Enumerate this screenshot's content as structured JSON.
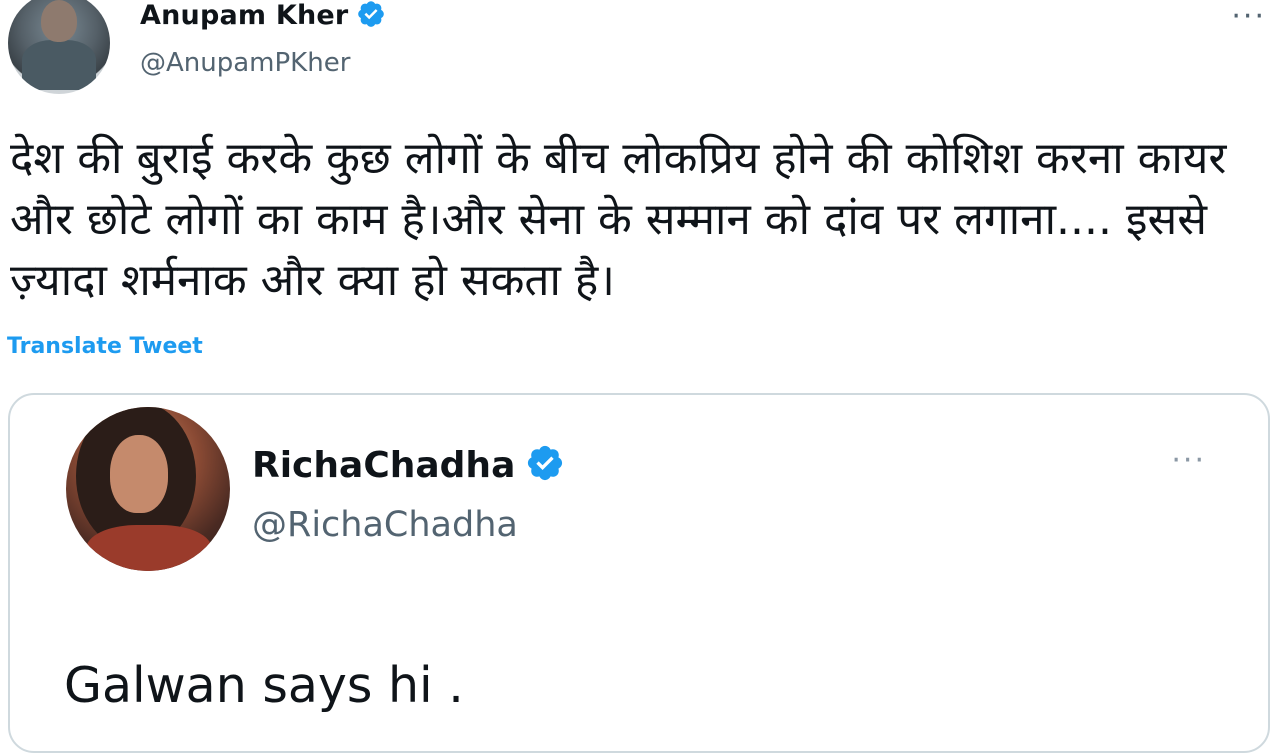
{
  "tweet": {
    "author": {
      "name": "Anupam Kher",
      "handle": "@AnupamPKher"
    },
    "more_label": "···",
    "text": "देश की बुराई करके कुछ लोगों के बीच लोकप्रिय होने की कोशिश करना कायर और छोटे लोगों का काम है।और सेना के सम्मान को दांव पर लगाना.... इससे ज़्यादा शर्मनाक और क्या हो सकता है।",
    "translate_label": "Translate Tweet"
  },
  "quoted_tweet": {
    "author": {
      "name": "RichaChadha",
      "handle": "@RichaChadha"
    },
    "more_label": "···",
    "text": "Galwan says hi ."
  },
  "colors": {
    "accent": "#1d9bf0",
    "text_primary": "#0f1419",
    "text_secondary": "#536471",
    "border": "#cfd9de"
  },
  "icons": {
    "verified": "verified-badge-icon",
    "more": "more-options-icon"
  }
}
